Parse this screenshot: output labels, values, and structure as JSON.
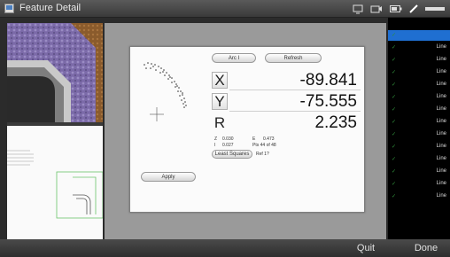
{
  "window": {
    "title": "Feature Detail"
  },
  "dialog": {
    "button_left": "Arc I",
    "button_right": "Refresh",
    "coords": [
      {
        "label": "X",
        "value": "-89.841"
      },
      {
        "label": "Y",
        "value": "-75.555"
      },
      {
        "label": "R",
        "value": "2.235"
      }
    ],
    "stats": {
      "row1_a_label": "Z",
      "row1_a_value": "0.030",
      "row1_b_label": "E",
      "row1_b_value": "0.473",
      "row2_a_label": "I",
      "row2_a_value": "0.027",
      "row2_b_text": "Pts 44 of 48",
      "fit_button": "Least Squares",
      "fit_note": "Ref 1?"
    },
    "apply_button": "Apply"
  },
  "right_list": {
    "items": [
      "",
      "Line",
      "Line",
      "Line",
      "Line",
      "Line",
      "Line",
      "Line",
      "Line",
      "Line",
      "Line",
      "Line",
      "Line",
      "Line"
    ],
    "selected_index": 0
  },
  "bottom_bar": {
    "quit": "Quit",
    "done": "Done"
  },
  "colors": {
    "selection": "#1f6fd1",
    "check": "#2f8f3a",
    "background": "#9a9a9a"
  }
}
